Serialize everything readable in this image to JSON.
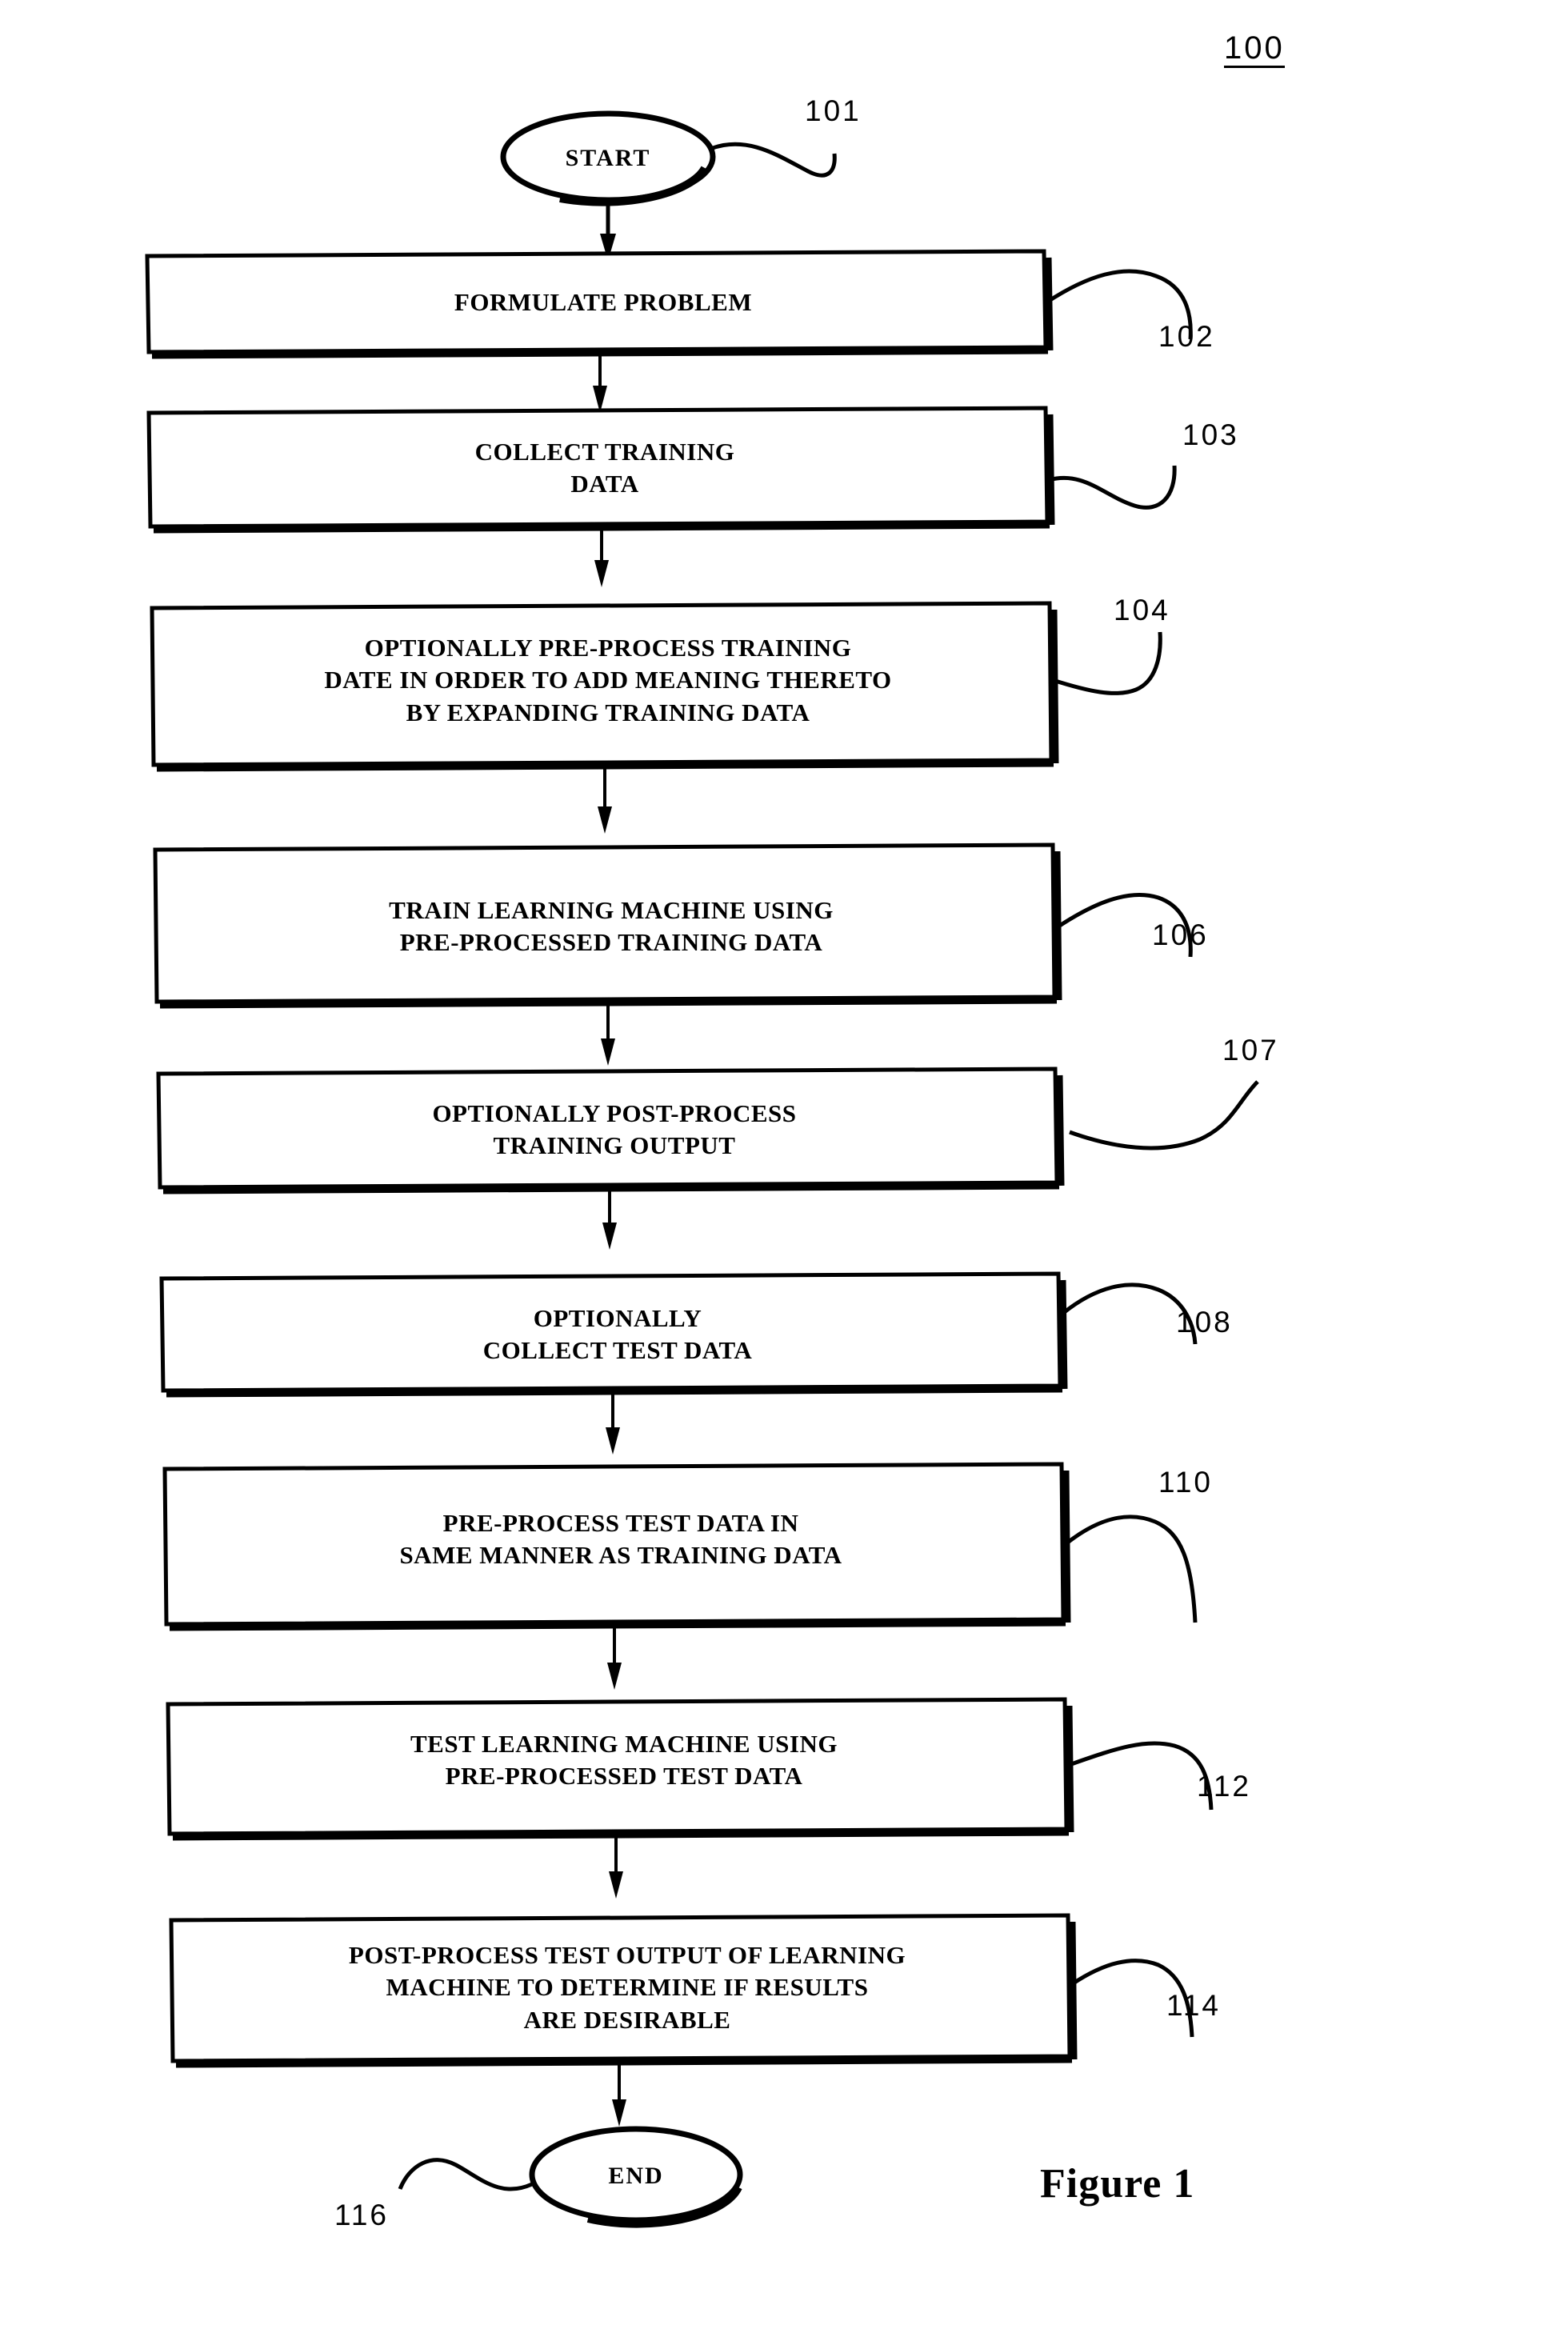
{
  "figure": {
    "diagram_ref": "100",
    "caption": "Figure 1"
  },
  "nodes": [
    {
      "id": "start",
      "shape": "ellipse",
      "label": "START",
      "ref": "101"
    },
    {
      "id": "formulate-problem",
      "shape": "process-box",
      "label": "FORMULATE  PROBLEM",
      "ref": "102"
    },
    {
      "id": "collect-training-data",
      "shape": "process-box",
      "label": "COLLECT TRAINING\nDATA",
      "ref": "103"
    },
    {
      "id": "pre-process-training-data",
      "shape": "process-box",
      "label": "OPTIONALLY PRE-PROCESS TRAINING\nDATE IN  ORDER TO ADD MEANING THERETO\nBY EXPANDING TRAINING DATA",
      "ref": "104"
    },
    {
      "id": "train-learning-machine",
      "shape": "process-box",
      "label": "TRAIN LEARNING MACHINE USING\nPRE-PROCESSED TRAINING DATA",
      "ref": "106"
    },
    {
      "id": "post-process-training-output",
      "shape": "process-box",
      "label": "OPTIONALLY POST-PROCESS\nTRAINING OUTPUT",
      "ref": "107"
    },
    {
      "id": "collect-test-data",
      "shape": "process-box",
      "label": "OPTIONALLY\nCOLLECT TEST DATA",
      "ref": "108"
    },
    {
      "id": "pre-process-test-data",
      "shape": "process-box",
      "label": "PRE-PROCESS TEST DATA IN\nSAME MANNER  AS TRAINING DATA",
      "ref": "110"
    },
    {
      "id": "test-learning-machine",
      "shape": "process-box",
      "label": "TEST LEARNING MACHINE USING\nPRE-PROCESSED TEST DATA",
      "ref": "112"
    },
    {
      "id": "post-process-test-output",
      "shape": "process-box",
      "label": "POST-PROCESS TEST OUTPUT OF LEARNING\nMACHINE TO DETERMINE IF RESULTS\nARE DESIRABLE",
      "ref": "114"
    },
    {
      "id": "end",
      "shape": "ellipse",
      "label": "END",
      "ref": "116"
    }
  ],
  "colors": {
    "ink": "#000000",
    "page": "#ffffff"
  }
}
